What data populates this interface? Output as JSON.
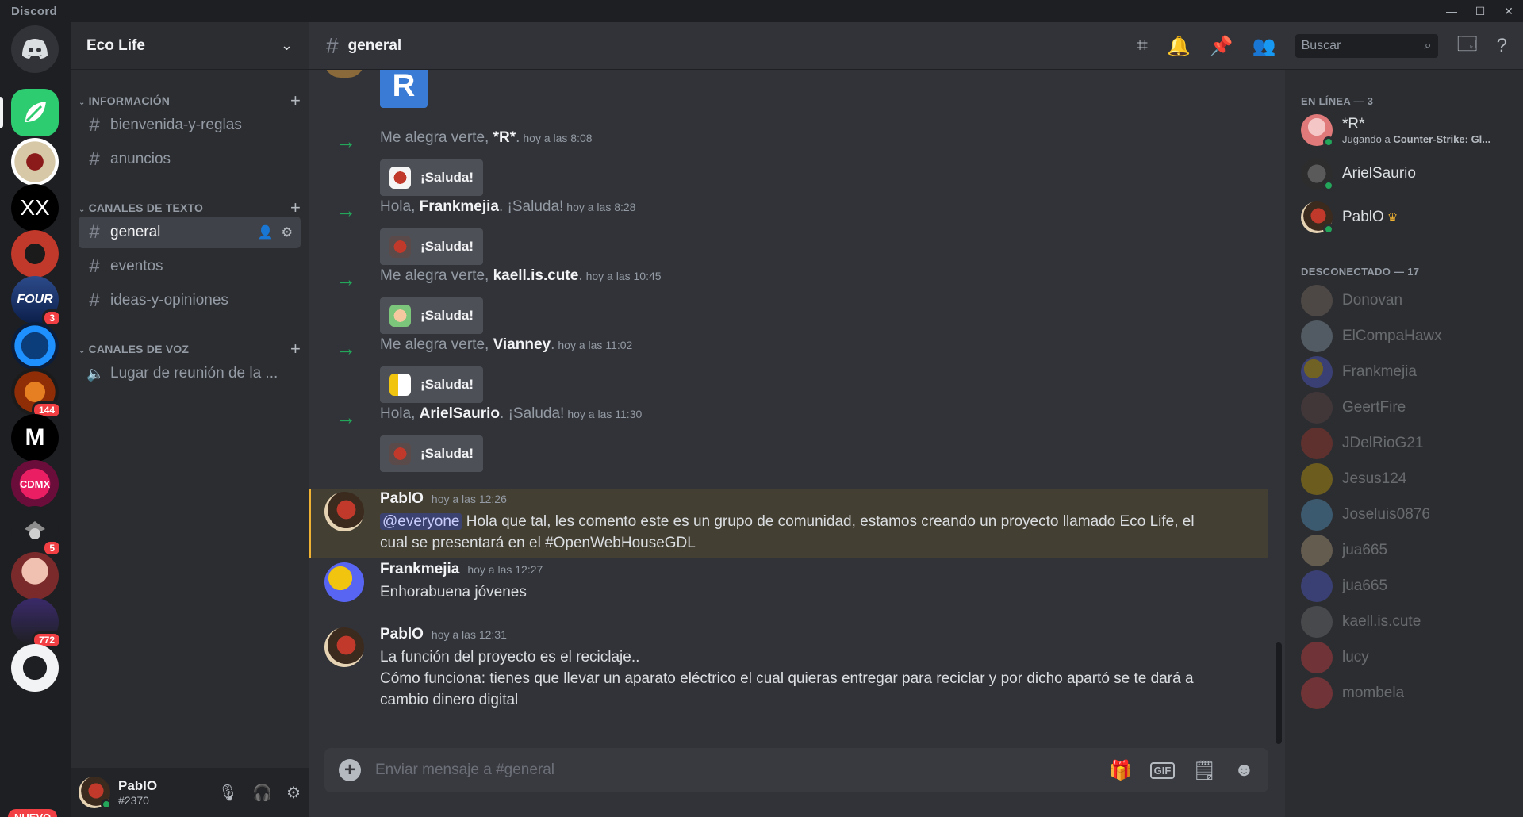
{
  "app": {
    "title": "Discord"
  },
  "guild": {
    "name": "Eco Life"
  },
  "rail": {
    "nuevo_label": "NUEVO",
    "badges": [
      "3",
      "144",
      "5",
      "772"
    ],
    "xx_label": "XX"
  },
  "categories": [
    {
      "label": "INFORMACIÓN"
    },
    {
      "label": "CANALES DE TEXTO"
    },
    {
      "label": "CANALES DE VOZ"
    }
  ],
  "channels": {
    "bienvenida": "bienvenida-y-reglas",
    "anuncios": "anuncios",
    "general": "general",
    "eventos": "eventos",
    "ideas": "ideas-y-opiniones",
    "voz": "Lugar de reunión de la ..."
  },
  "header": {
    "channel": "general",
    "search_placeholder": "Buscar"
  },
  "join_messages": [
    {
      "prefix": "Me alegra verte, ",
      "user": "*R*",
      "suffix": ".",
      "time": "hoy a las 8:08",
      "wave": "¡Saluda!"
    },
    {
      "prefix": "Hola, ",
      "user": "Frankmejia",
      "suffix": ". ¡Saluda!",
      "time": "hoy a las 8:28",
      "wave": "¡Saluda!"
    },
    {
      "prefix": "Me alegra verte, ",
      "user": "kaell.is.cute",
      "suffix": ".",
      "time": "hoy a las 10:45",
      "wave": "¡Saluda!"
    },
    {
      "prefix": "Me alegra verte, ",
      "user": "Vianney",
      "suffix": ".",
      "time": "hoy a las 11:02",
      "wave": "¡Saluda!"
    },
    {
      "prefix": "Hola, ",
      "user": "ArielSaurio",
      "suffix": ". ¡Saluda!",
      "time": "hoy a las 11:30",
      "wave": "¡Saluda!"
    }
  ],
  "messages": [
    {
      "author": "PablO",
      "time": "hoy a las 12:26",
      "mention": "@everyone",
      "text": " Hola que tal, les comento este es un grupo de comunidad, estamos creando un proyecto llamado Eco Life, el cual se presentará en el #OpenWebHouseGDL"
    },
    {
      "author": "Frankmejia",
      "time": "hoy a las 12:27",
      "text": "Enhorabuena jóvenes"
    },
    {
      "author": "PablO",
      "time": "hoy a las 12:31",
      "line1": "La función del proyecto es el reciclaje..",
      "line2": "Cómo funciona: tienes que llevar un aparato eléctrico el cual quieras entregar para reciclar y por dicho apartó se te dará a cambio dinero digital"
    }
  ],
  "composer": {
    "placeholder": "Enviar mensaje a #general",
    "gif_label": "GIF"
  },
  "user": {
    "name": "PablO",
    "tag": "#2370"
  },
  "members": {
    "online_label": "EN LÍNEA — 3",
    "offline_label": "DESCONECTADO — 17",
    "online": [
      {
        "name": "*R*",
        "activity_prefix": "Jugando a ",
        "activity": "Counter-Strike: Gl..."
      },
      {
        "name": "ArielSaurio"
      },
      {
        "name": "PablO"
      }
    ],
    "offline": [
      "Donovan",
      "ElCompaHawx",
      "Frankmejia",
      "GeertFire",
      "JDelRioG21",
      "Jesus124",
      "Joseluis0876",
      "jua665",
      "jua665",
      "kaell.is.cute",
      "lucy",
      "mombela"
    ]
  },
  "colors": {
    "accent": "#5865f2",
    "online": "#23a55a",
    "danger": "#f23f43",
    "mention": "#f0b232"
  }
}
